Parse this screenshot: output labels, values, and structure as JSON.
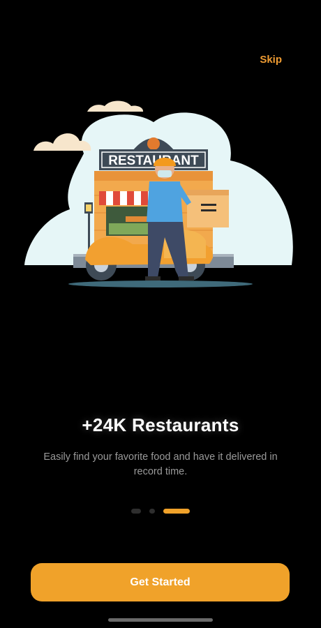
{
  "header": {
    "skip_label": "Skip"
  },
  "illustration": {
    "sign_text": "RESTAURANT"
  },
  "onboarding": {
    "title": "+24K Restaurants",
    "subtitle": "Easily find your favorite food and have it delivered in record time.",
    "pages_total": 3,
    "current_page": 3
  },
  "footer": {
    "cta_label": "Get Started"
  },
  "colors": {
    "background": "#000000",
    "accent": "#F0A22A",
    "subtitle": "#9A9A9A"
  }
}
